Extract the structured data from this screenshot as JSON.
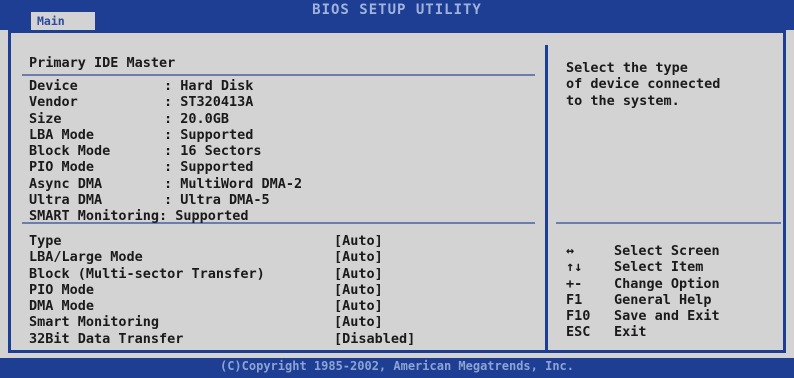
{
  "header": {
    "title": "BIOS SETUP UTILITY",
    "tab_main": "Main"
  },
  "section_title": "Primary IDE Master",
  "device_info": [
    {
      "key": "Device",
      "value": ": Hard Disk"
    },
    {
      "key": "Vendor",
      "value": ": ST320413A"
    },
    {
      "key": "Size",
      "value": ": 20.0GB"
    },
    {
      "key": "LBA Mode",
      "value": ": Supported"
    },
    {
      "key": "Block Mode",
      "value": ": 16 Sectors"
    },
    {
      "key": "PIO Mode",
      "value": ": Supported"
    },
    {
      "key": "Async DMA",
      "value": ": MultiWord DMA-2"
    },
    {
      "key": "Ultra DMA",
      "value": ": Ultra DMA-5"
    }
  ],
  "smart_line": "SMART Monitoring: Supported",
  "options": [
    {
      "label": "Type",
      "value": "[Auto]"
    },
    {
      "label": "LBA/Large Mode",
      "value": "[Auto]"
    },
    {
      "label": "Block (Multi-sector Transfer)",
      "value": "[Auto]"
    },
    {
      "label": "PIO Mode",
      "value": "[Auto]"
    },
    {
      "label": "DMA Mode",
      "value": "[Auto]"
    },
    {
      "label": "Smart Monitoring",
      "value": "[Auto]"
    },
    {
      "label": "32Bit Data Transfer",
      "value": "[Disabled]"
    }
  ],
  "help_text": [
    "Select the type",
    "of device connected",
    "to the system."
  ],
  "keys": [
    {
      "key": "↔",
      "desc": "Select Screen"
    },
    {
      "key": "↑↓",
      "desc": "Select Item"
    },
    {
      "key": "+-",
      "desc": "Change Option"
    },
    {
      "key": "F1",
      "desc": "General Help"
    },
    {
      "key": "F10",
      "desc": "Save and Exit"
    },
    {
      "key": "ESC",
      "desc": "Exit"
    }
  ],
  "footer": {
    "copyright": "(C)Copyright 1985-2002, American Megatrends, Inc."
  }
}
